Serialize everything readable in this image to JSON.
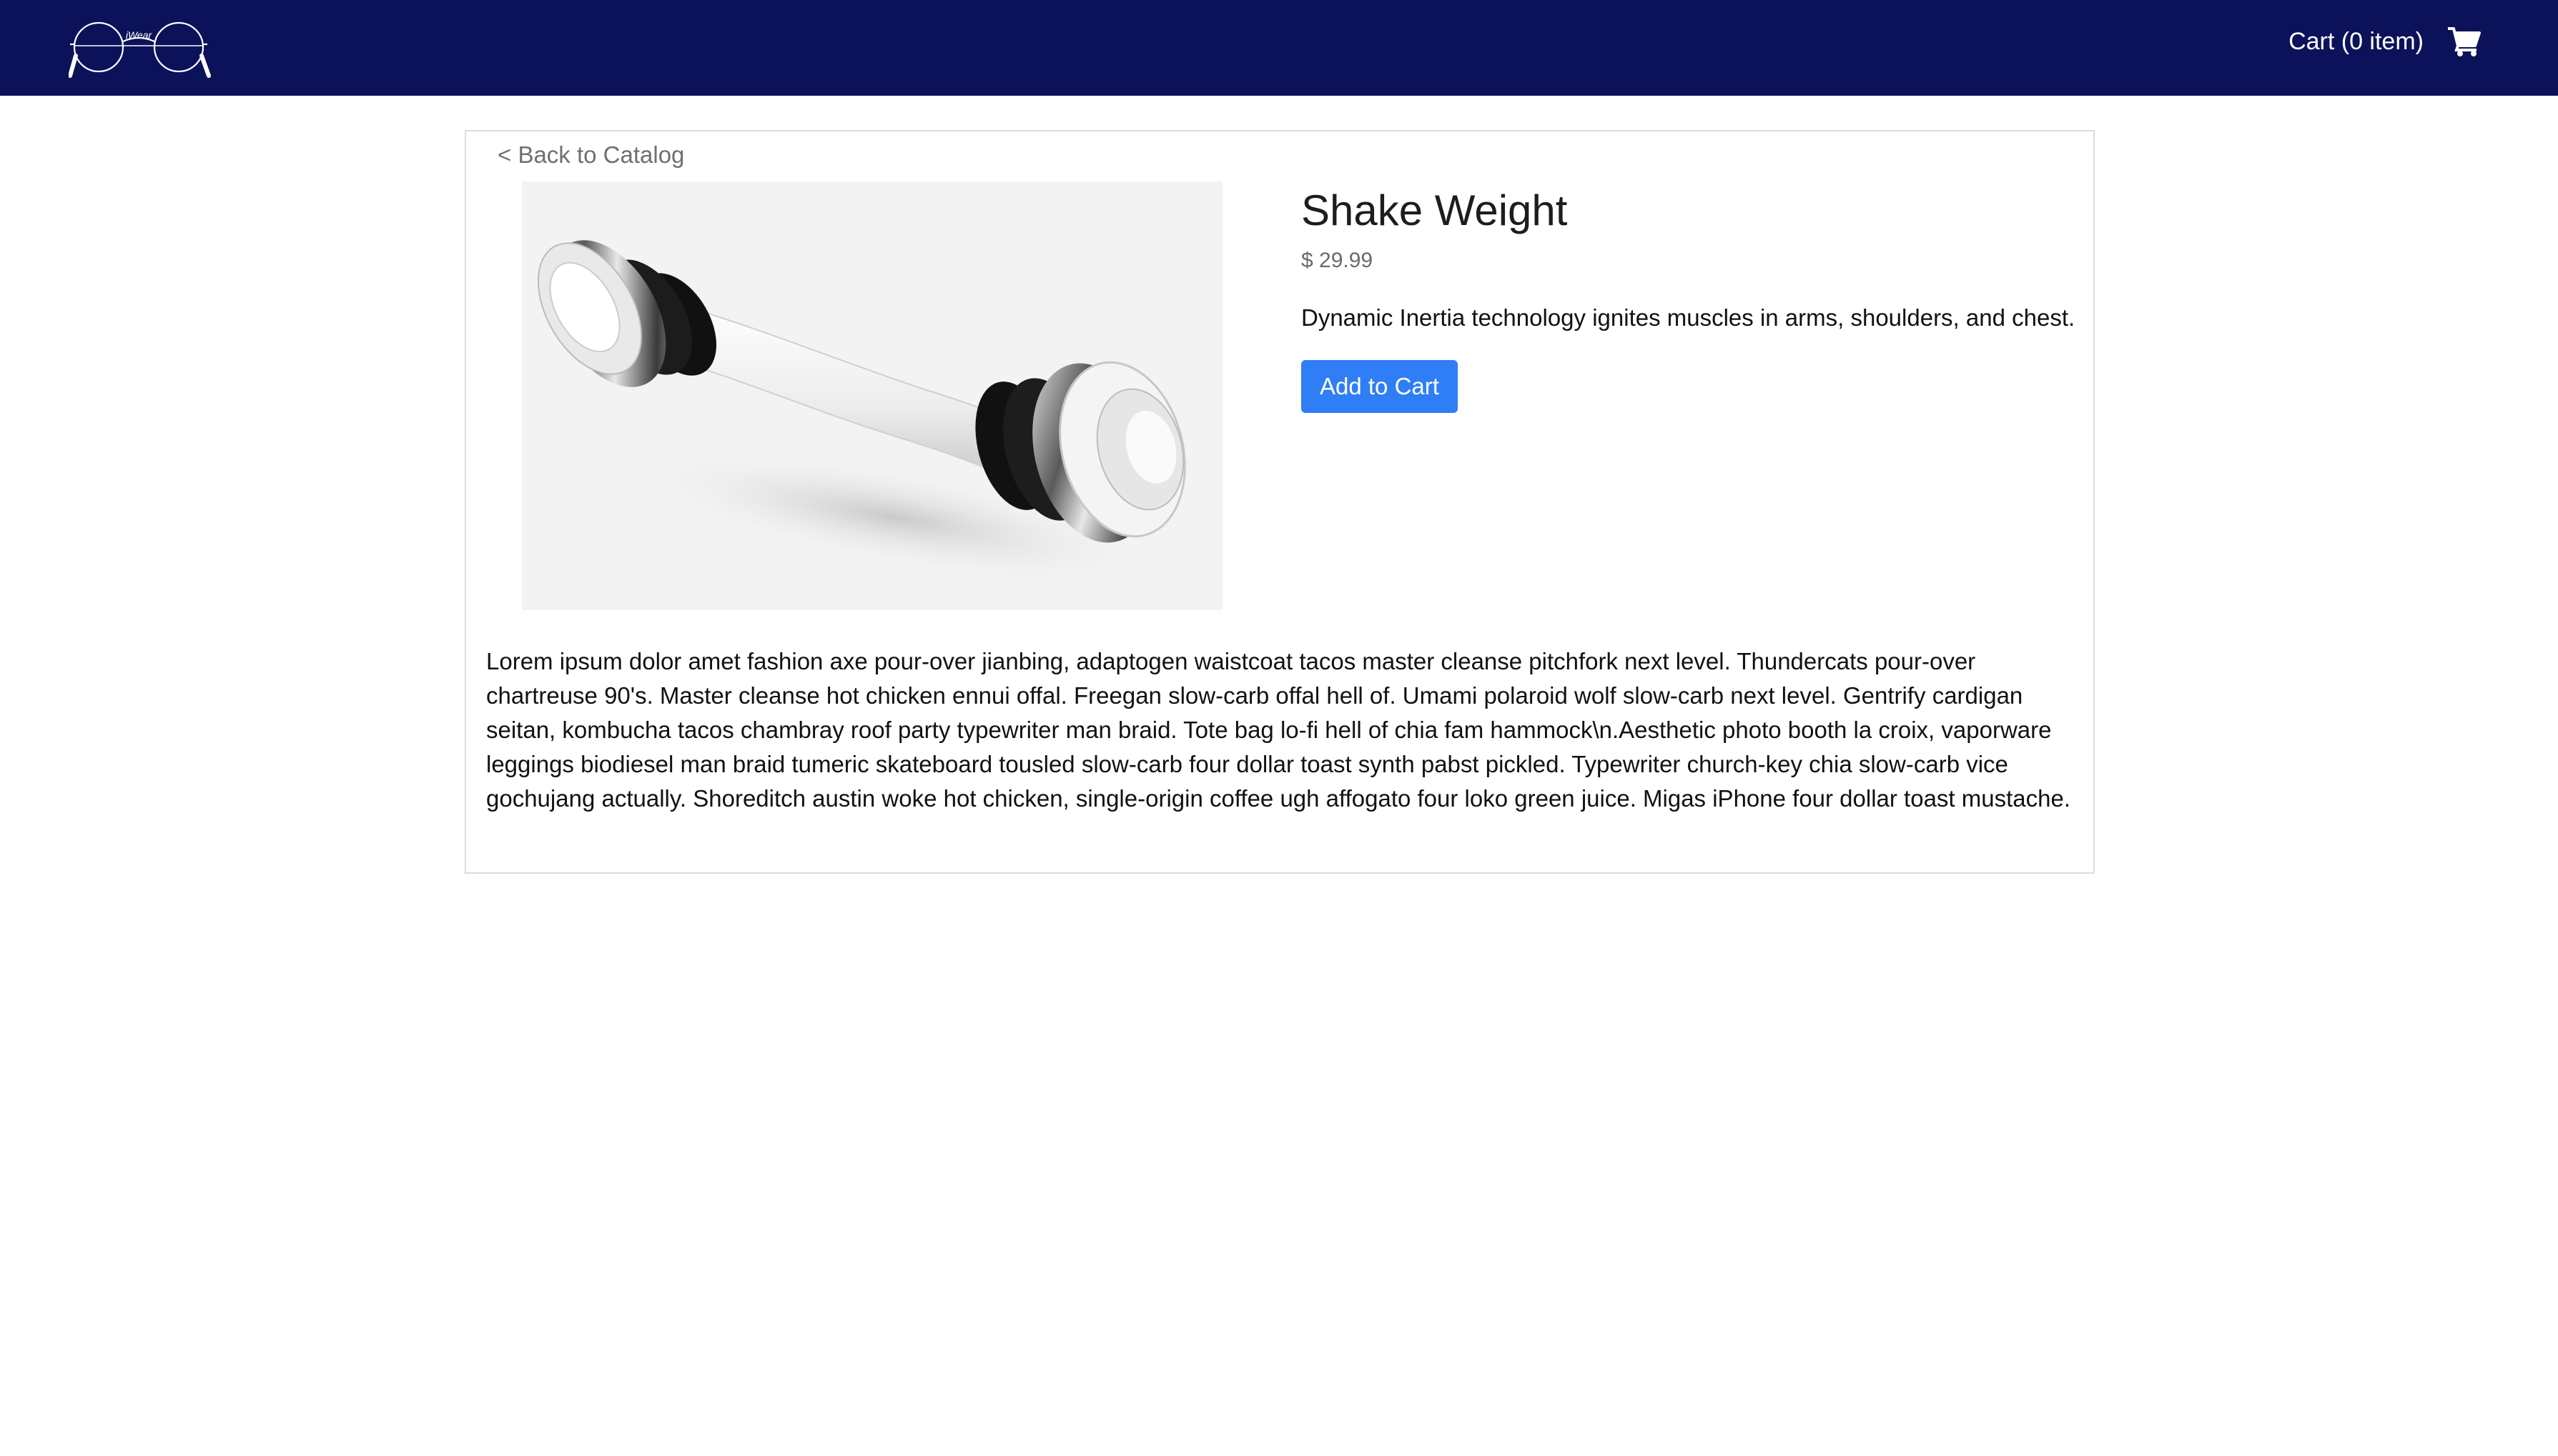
{
  "header": {
    "logo_text": "iWear",
    "cart_label": "Cart (0 item)",
    "icons": {
      "logo": "glasses-logo-icon",
      "cart": "shopping-cart-icon"
    }
  },
  "product": {
    "back_label": "< Back to Catalog",
    "title": "Shake Weight",
    "price": "$ 29.99",
    "short_description": "Dynamic Inertia technology ignites muscles in arms, shoulders, and chest.",
    "add_to_cart_label": "Add to Cart",
    "long_description": "Lorem ipsum dolor amet fashion axe pour-over jianbing, adaptogen waistcoat tacos master cleanse pitchfork next level. Thundercats pour-over chartreuse 90's. Master cleanse hot chicken ennui offal. Freegan slow-carb offal hell of. Umami polaroid wolf slow-carb next level. Gentrify cardigan seitan, kombucha tacos chambray roof party typewriter man braid. Tote bag lo-fi hell of chia fam hammock\\n.Aesthetic photo booth la croix, vaporware leggings biodiesel man braid tumeric skateboard tousled slow-carb four dollar toast synth pabst pickled. Typewriter church-key chia slow-carb vice gochujang actually. Shoreditch austin woke hot chicken, single-origin coffee ugh affogato four loko green juice. Migas iPhone four dollar toast mustache.",
    "image_subject": "shake-weight-dumbbell"
  },
  "colors": {
    "navbar": "#0b125a",
    "button": "#2f7ef5",
    "muted_text": "#6f6f6f",
    "panel_border": "#dcdcdc"
  }
}
